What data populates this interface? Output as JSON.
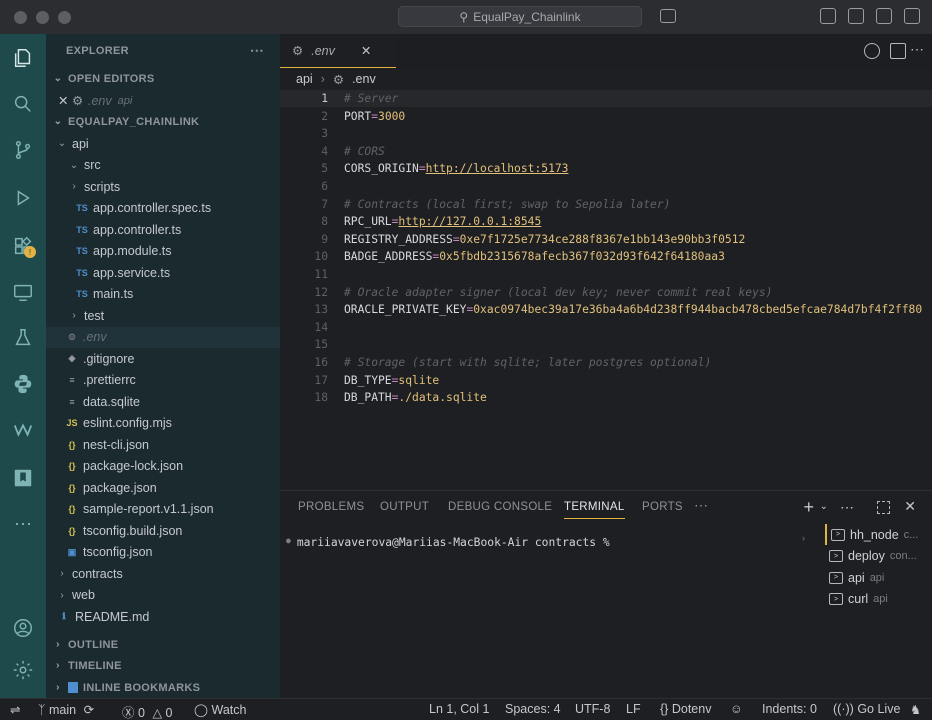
{
  "window": {
    "title": "EqualPay_Chainlink"
  },
  "sidebar": {
    "header": "EXPLORER",
    "open_editors_label": "OPEN EDITORS",
    "open_editor_file": ".env",
    "open_editor_folder": "api",
    "project_label": "EQUALPAY_CHAINLINK",
    "tree": [
      {
        "label": "api",
        "kind": "folder-open"
      },
      {
        "label": "src",
        "kind": "folder-open"
      },
      {
        "label": "scripts",
        "kind": "folder"
      },
      {
        "label": "app.controller.spec.ts",
        "kind": "ts"
      },
      {
        "label": "app.controller.ts",
        "kind": "ts"
      },
      {
        "label": "app.module.ts",
        "kind": "ts"
      },
      {
        "label": "app.service.ts",
        "kind": "ts"
      },
      {
        "label": "main.ts",
        "kind": "ts"
      },
      {
        "label": "test",
        "kind": "folder"
      },
      {
        "label": ".env",
        "kind": "gear"
      },
      {
        "label": ".gitignore",
        "kind": "git"
      },
      {
        "label": ".prettierrc",
        "kind": "txt"
      },
      {
        "label": "data.sqlite",
        "kind": "txt"
      },
      {
        "label": "eslint.config.mjs",
        "kind": "js"
      },
      {
        "label": "nest-cli.json",
        "kind": "json"
      },
      {
        "label": "package-lock.json",
        "kind": "json"
      },
      {
        "label": "package.json",
        "kind": "json"
      },
      {
        "label": "sample-report.v1.1.json",
        "kind": "json"
      },
      {
        "label": "tsconfig.build.json",
        "kind": "json"
      },
      {
        "label": "tsconfig.json",
        "kind": "tsconfig"
      },
      {
        "label": "contracts",
        "kind": "folder"
      },
      {
        "label": "web",
        "kind": "folder"
      },
      {
        "label": "README.md",
        "kind": "md"
      }
    ],
    "outline_label": "OUTLINE",
    "timeline_label": "TIMELINE",
    "bookmarks_label": "INLINE BOOKMARKS"
  },
  "editor": {
    "tab_label": ".env",
    "breadcrumb_folder": "api",
    "breadcrumb_file": ".env",
    "lines": [
      {
        "n": "1",
        "comment": "# Server"
      },
      {
        "n": "2",
        "key": "PORT",
        "value": "3000"
      },
      {
        "n": "3"
      },
      {
        "n": "4",
        "comment": "# CORS"
      },
      {
        "n": "5",
        "key": "CORS_ORIGIN",
        "value": "http://localhost:5173"
      },
      {
        "n": "6"
      },
      {
        "n": "7",
        "comment": "# Contracts (local first; swap to Sepolia later)"
      },
      {
        "n": "8",
        "key": "RPC_URL",
        "value": "http://127.0.0.1:8545"
      },
      {
        "n": "9",
        "key": "REGISTRY_ADDRESS",
        "value": "0xe7f1725e7734ce288f8367e1bb143e90bb3f0512"
      },
      {
        "n": "10",
        "key": "BADGE_ADDRESS",
        "value": "0x5fbdb2315678afecb367f032d93f642f64180aa3"
      },
      {
        "n": "11"
      },
      {
        "n": "12",
        "comment": "# Oracle adapter signer (local dev key; never commit real keys)"
      },
      {
        "n": "13",
        "key": "ORACLE_PRIVATE_KEY",
        "value": "0xac0974bec39a17e36ba4a6b4d238ff944bacb478cbed5efcae784d7bf4f2ff80"
      },
      {
        "n": "14"
      },
      {
        "n": "15"
      },
      {
        "n": "16",
        "comment": "# Storage (start with sqlite; later postgres optional)"
      },
      {
        "n": "17",
        "key": "DB_TYPE",
        "value": "sqlite"
      },
      {
        "n": "18",
        "key": "DB_PATH",
        "value": "./data.sqlite"
      }
    ]
  },
  "panel": {
    "tabs": [
      "PROBLEMS",
      "OUTPUT",
      "DEBUG CONSOLE",
      "TERMINAL",
      "PORTS"
    ],
    "active_tab": "TERMINAL",
    "prompt": "mariiavaverova@Mariias-MacBook-Air contracts %",
    "terminals": [
      {
        "name": "hh_node",
        "sub": "c..."
      },
      {
        "name": "deploy",
        "sub": "con..."
      },
      {
        "name": "api",
        "sub": "api"
      },
      {
        "name": "curl",
        "sub": "api"
      }
    ]
  },
  "statusbar": {
    "branch": "main",
    "errors": "0",
    "warnings": "0",
    "watch": "Watch",
    "cursor": "Ln 1, Col 1",
    "spaces": "Spaces: 4",
    "encoding": "UTF-8",
    "eol": "LF",
    "language": "Dotenv",
    "indents": "Indents: 0",
    "golive": "Go Live"
  },
  "colors": {
    "accent": "#e3b341",
    "activity_bar": "#1f4a4c",
    "sidebar": "#1b2a2f"
  }
}
